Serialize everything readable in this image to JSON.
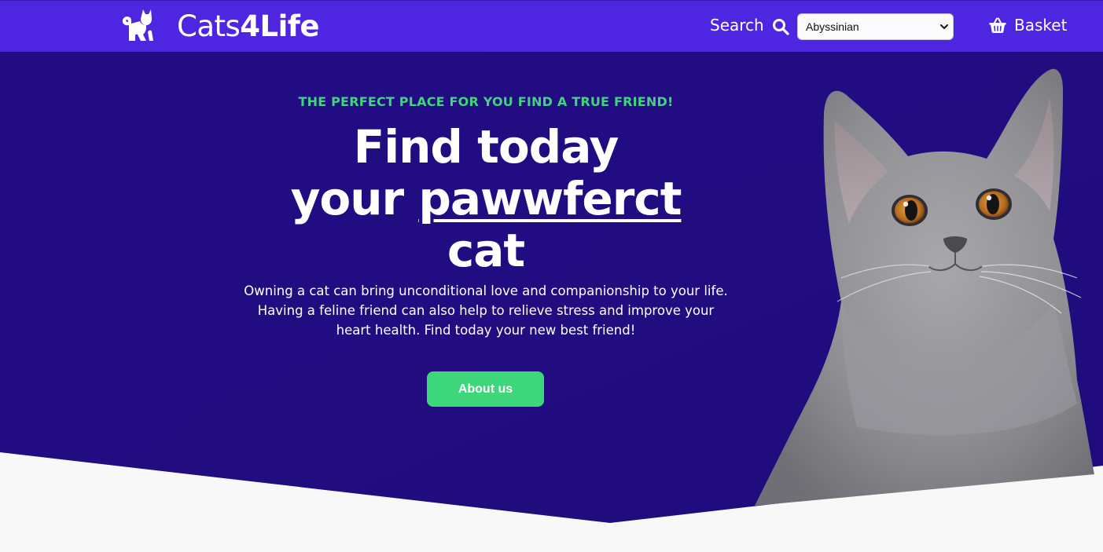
{
  "header": {
    "logo": {
      "light": "Cats",
      "bold": "4Life",
      "icon": "cat-logo-icon"
    },
    "search_label": "Search",
    "search_icon": "search-icon",
    "breed_select": {
      "selected": "Abyssinian",
      "options": [
        "Abyssinian"
      ]
    },
    "basket_label": "Basket",
    "basket_icon": "basket-icon"
  },
  "hero": {
    "eyebrow": "THE PERFECT PLACE FOR YOU FIND A TRUE FRIEND!",
    "headline": {
      "line1": "Find today",
      "line2_prefix": "your ",
      "line2_underlined": "pawwferct",
      "line3": "cat"
    },
    "lead": "Owning a cat can bring unconditional love and companionship to your life. Having a feline friend can also help to relieve stress and improve your heart health. Find today your new best friend!",
    "cta_label": "About us"
  },
  "colors": {
    "nav_bg": "#4e26e2",
    "hero_bg": "#220d80",
    "accent_green": "#3ed57c",
    "page_bg": "#f8f8f9"
  }
}
